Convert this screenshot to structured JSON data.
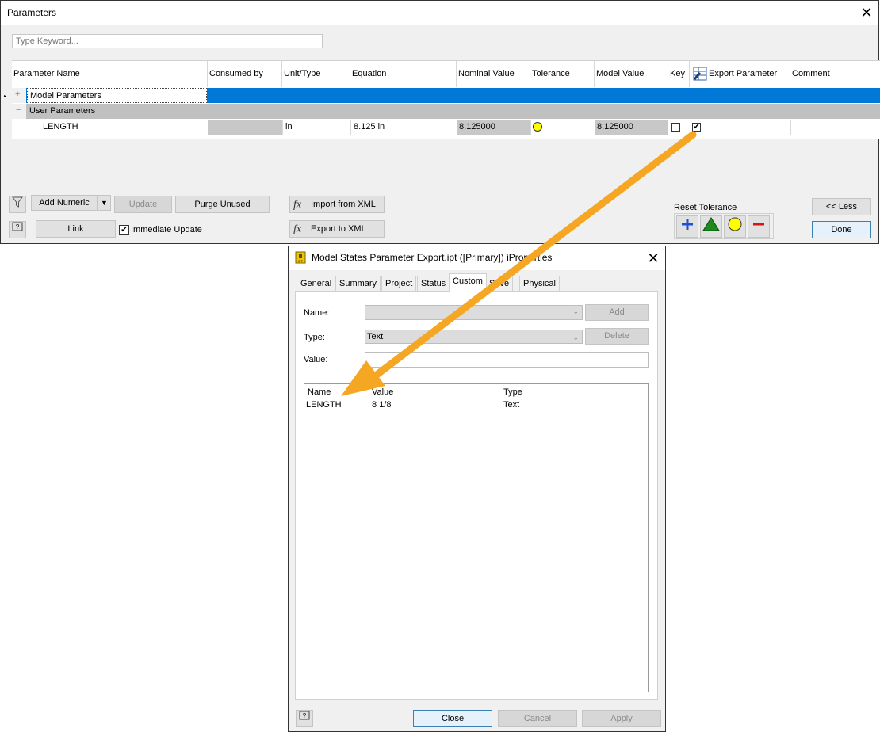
{
  "parameters_dialog": {
    "title": "Parameters",
    "search_placeholder": "Type Keyword...",
    "columns": [
      "Parameter Name",
      "Consumed by",
      "Unit/Type",
      "Equation",
      "Nominal Value",
      "Tolerance",
      "Model Value",
      "Key",
      "Export Parameter",
      "Comment"
    ],
    "rows": {
      "model_params": "Model Parameters",
      "user_params": "User Parameters",
      "length": {
        "name": "LENGTH",
        "unit": "in",
        "equation": "8.125 in",
        "nominal": "8.125000",
        "model_value": "8.125000",
        "key_checked": false,
        "export_checked": true
      }
    },
    "buttons": {
      "add_numeric": "Add Numeric",
      "update": "Update",
      "purge_unused": "Purge Unused",
      "import_xml": "Import from XML",
      "link": "Link",
      "immediate_update": "Immediate Update",
      "export_xml": "Export to XML",
      "less": "<< Less",
      "done": "Done"
    },
    "reset_tolerance_label": "Reset Tolerance",
    "colors": {
      "selected_row": "#0078d7",
      "gray_row": "#c0c0c0",
      "tolerance_circle": "#ffff00"
    }
  },
  "iproperties_dialog": {
    "title": "Model States Parameter Export.ipt ([Primary]) iProperties",
    "tabs": [
      "General",
      "Summary",
      "Project",
      "Status",
      "Custom",
      "Save",
      "Physical"
    ],
    "active_tab": "Custom",
    "labels": {
      "name": "Name:",
      "type": "Type:",
      "value": "Value:"
    },
    "type_value": "Text",
    "buttons": {
      "add": "Add",
      "delete": "Delete",
      "close": "Close",
      "cancel": "Cancel",
      "apply": "Apply"
    },
    "list": {
      "headers": [
        "Name",
        "Value",
        "Type"
      ],
      "rows": [
        {
          "name": "LENGTH",
          "value": "8 1/8",
          "type": "Text"
        }
      ]
    }
  },
  "arrow_color": "#f5a623"
}
